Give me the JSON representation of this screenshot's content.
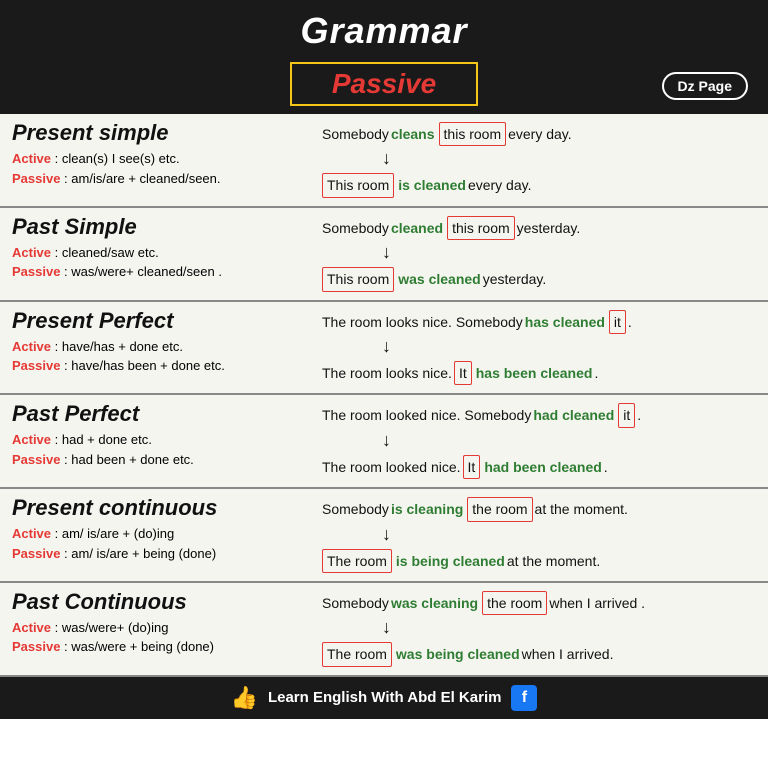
{
  "header": {
    "title": "Grammar",
    "passive_label": "Passive",
    "dz_page": "Dz Page"
  },
  "sections": [
    {
      "id": "present-simple",
      "title": "Present simple",
      "active_rule": "Active : clean(s) I see(s) etc.",
      "passive_rule": "Passive : am/is/are + cleaned/seen.",
      "example_active": [
        "Somebody ",
        "cleans",
        " ",
        "this room",
        " every day."
      ],
      "example_passive": [
        "This room",
        " is cleaned every day."
      ],
      "passive_verb": "is cleaned"
    },
    {
      "id": "past-simple",
      "title": "Past Simple",
      "active_rule": "Active : cleaned/saw etc.",
      "passive_rule": "Passive : was/were+ cleaned/seen .",
      "example_active": [
        "Somebody ",
        "cleaned",
        " ",
        "this room",
        " yesterday."
      ],
      "example_passive": [
        "This room",
        " was cleaned yesterday."
      ],
      "passive_verb": "was cleaned"
    },
    {
      "id": "present-perfect",
      "title": "Present Perfect",
      "active_rule": "Active : have/has + done etc.",
      "passive_rule": "Passive : have/has been + done etc.",
      "example_active": [
        "The room looks nice. Somebody ",
        "has cleaned",
        " ",
        "it",
        "."
      ],
      "example_passive": [
        "The room looks nice. ",
        "It",
        " has been cleaned."
      ],
      "passive_verb": "has been cleaned"
    },
    {
      "id": "past-perfect",
      "title": "Past Perfect",
      "active_rule": "Active : had + done etc.",
      "passive_rule": "Passive : had been + done etc.",
      "example_active": [
        "The room looked nice. Somebody ",
        "had cleaned",
        " ",
        "it",
        "."
      ],
      "example_passive": [
        "The room looked nice. ",
        "It",
        " had been cleaned."
      ],
      "passive_verb": "had been cleaned"
    },
    {
      "id": "present-continuous",
      "title": "Present continuous",
      "active_rule": "Active : am/ is/are + (do)ing",
      "passive_rule": "Passive : am/ is/are + being (done)",
      "example_active": [
        "Somebody ",
        "is cleaning",
        " ",
        "the room",
        " at the moment."
      ],
      "example_passive": [
        "The room",
        " is being cleaned at the moment."
      ],
      "passive_verb": "is being cleaned"
    },
    {
      "id": "past-continuous",
      "title": "Past Continuous",
      "active_rule": "Active : was/were+ (do)ing",
      "passive_rule": "Passive : was/were + being (done)",
      "example_active": [
        "Somebody ",
        "was cleaning",
        " ",
        "the room",
        " when I arrived ."
      ],
      "example_passive": [
        "The room",
        " was being cleaned when I arrived."
      ],
      "passive_verb": "was being cleaned"
    }
  ],
  "footer": {
    "label": "Learn English With Abd El Karim"
  }
}
